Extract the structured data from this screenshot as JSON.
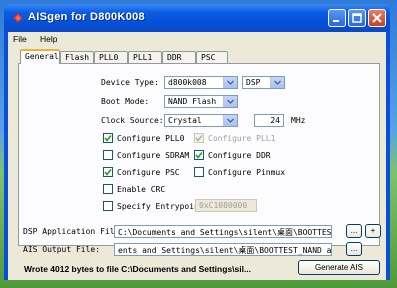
{
  "window": {
    "title": "AISgen for D800K008"
  },
  "menu": [
    "File",
    "Help"
  ],
  "tabs": [
    "General",
    "Flash",
    "PLL0",
    "PLL1",
    "DDR",
    "PSC"
  ],
  "general": {
    "device_type_label": "Device Type:",
    "device_type_value": "d800k008",
    "device_type_core": "DSP",
    "boot_mode_label": "Boot Mode:",
    "boot_mode_value": "NAND Flash",
    "clock_source_label": "Clock Source:",
    "clock_source_value": "Crystal",
    "clock_freq_value": "24",
    "clock_unit": "MHz",
    "checkboxes": [
      {
        "label": "Configure PLL0",
        "checked": true,
        "enabled": true
      },
      {
        "label": "Configure PLL1",
        "checked": true,
        "enabled": false
      },
      {
        "label": "Configure SDRAM",
        "checked": false,
        "enabled": true
      },
      {
        "label": "Configure DDR",
        "checked": true,
        "enabled": true
      },
      {
        "label": "Configure PSC",
        "checked": true,
        "enabled": true
      },
      {
        "label": "Configure Pinmux",
        "checked": false,
        "enabled": true
      },
      {
        "label": "Enable CRC",
        "checked": false,
        "enabled": true
      },
      {
        "label": "Specify Entrypoin",
        "checked": false,
        "enabled": true
      }
    ],
    "entrypoint_value": "0xC1080000"
  },
  "files": {
    "dsp_label": "DSP Application File",
    "dsp_value": "C:\\Documents and Settings\\silent\\桌面\\BOOTTEST.",
    "ais_label": "AIS Output File:",
    "ais_value": "ents and Settings\\silent\\桌面\\BOOTTEST_NAND ais",
    "browse_label": "...",
    "add_label": "+"
  },
  "status": "Wrote 4012 bytes to file C:\\Documents and Settings\\sil...",
  "generate_label": "Generate AIS"
}
